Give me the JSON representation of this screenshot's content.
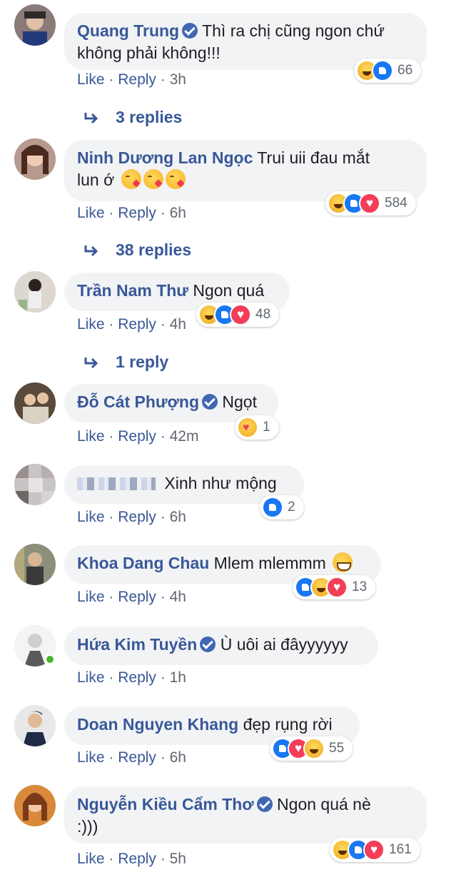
{
  "comments": [
    {
      "name": "Quang Trung",
      "verified": true,
      "text_line1": "Thì ra chị cũng ngon chứ",
      "text_line2": "không phải không!!!",
      "actions": {
        "like": "Like",
        "reply": "Reply",
        "time": "3h"
      },
      "reactions": [
        "haha",
        "like"
      ],
      "reaction_count": "66",
      "replies_label": "3 replies"
    },
    {
      "name": "Ninh Dương Lan Ngọc",
      "verified": false,
      "text_line1": "Trui uii đau mắt",
      "text_line2": "lun ớ",
      "emojis": [
        "kissing-heart",
        "kissing-heart",
        "kissing-heart"
      ],
      "actions": {
        "like": "Like",
        "reply": "Reply",
        "time": "6h"
      },
      "reactions": [
        "haha",
        "like",
        "love"
      ],
      "reaction_count": "584",
      "replies_label": "38 replies"
    },
    {
      "name": "Trần Nam Thư",
      "verified": false,
      "text_line1": "Ngon quá",
      "actions": {
        "like": "Like",
        "reply": "Reply",
        "time": "4h"
      },
      "reactions": [
        "haha",
        "like",
        "love"
      ],
      "reaction_count": "48",
      "replies_label": "1 reply"
    },
    {
      "name": "Đỗ Cát Phượng",
      "verified": true,
      "text_line1": "Ngọt",
      "actions": {
        "like": "Like",
        "reply": "Reply",
        "time": "42m"
      },
      "reactions": [
        "care"
      ],
      "reaction_count": "1"
    },
    {
      "name": "",
      "name_blurred": true,
      "verified": false,
      "text_line1": "Xinh như mộng",
      "actions": {
        "like": "Like",
        "reply": "Reply",
        "time": "6h"
      },
      "reactions": [
        "like"
      ],
      "reaction_count": "2"
    },
    {
      "name": "Khoa Dang Chau",
      "verified": false,
      "text_line1": "Mlem mlemmm",
      "emojis": [
        "grinning-face"
      ],
      "actions": {
        "like": "Like",
        "reply": "Reply",
        "time": "4h"
      },
      "reactions": [
        "like",
        "haha",
        "love"
      ],
      "reaction_count": "13"
    },
    {
      "name": "Hứa Kim Tuyền",
      "verified": true,
      "online": true,
      "text_line1": "Ù uôi ai đâyyyyyy",
      "actions": {
        "like": "Like",
        "reply": "Reply",
        "time": "1h"
      }
    },
    {
      "name": "Doan Nguyen Khang",
      "verified": false,
      "text_line1": "đẹp rụng rời",
      "actions": {
        "like": "Like",
        "reply": "Reply",
        "time": "6h"
      },
      "reactions": [
        "like",
        "love",
        "haha"
      ],
      "reaction_count": "55"
    },
    {
      "name": "Nguyễn Kiều Cẩm Thơ",
      "verified": true,
      "text_line1": "Ngon quá nè",
      "text_line2": ":)))",
      "actions": {
        "like": "Like",
        "reply": "Reply",
        "time": "5h"
      },
      "reactions": [
        "haha",
        "like",
        "love"
      ],
      "reaction_count": "161"
    }
  ],
  "separator": "·",
  "colors": {
    "name": "#385898",
    "bubble": "#f2f3f5",
    "meta": "#606770",
    "online": "#42b72a"
  }
}
